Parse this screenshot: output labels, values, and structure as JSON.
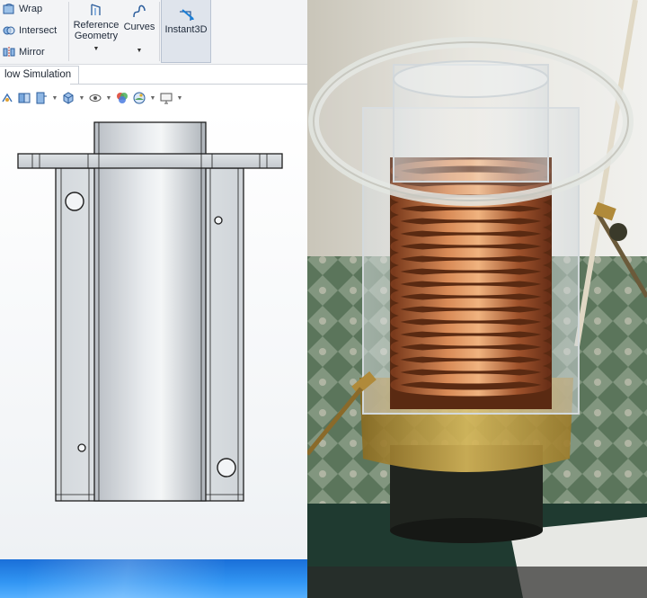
{
  "ribbon": {
    "wrap_label": "Wrap",
    "intersect_label": "Intersect",
    "mirror_label": "Mirror",
    "reference_geometry_label_line1": "Reference",
    "reference_geometry_label_line2": "Geometry",
    "curves_label": "Curves",
    "instant3d_label": "Instant3D"
  },
  "tabs": {
    "flow_simulation_label": "low Simulation"
  },
  "hud": {
    "icons": [
      "view-orientation-icon",
      "section-view-icon",
      "display-style-icon",
      "hide-show-icon",
      "appearance-icon",
      "scene-icon",
      "monitor-icon"
    ]
  },
  "colors": {
    "ribbon_bg": "#f3f4f6",
    "instant3d_active": "#dfe4ec",
    "viewport_bg": "#ffffff",
    "model_edge": "#1e1e1e",
    "taskbar_blue": "#2a86ea",
    "copper": "#b8673a",
    "acrylic": "#e8ecef",
    "base_brass": "#c8a64a"
  }
}
